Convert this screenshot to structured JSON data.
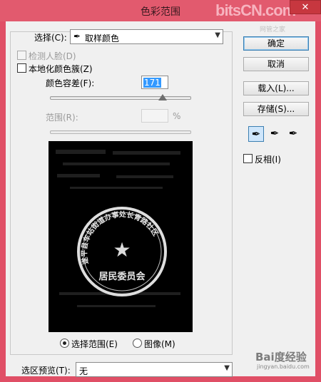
{
  "window": {
    "title": "色彩范围",
    "close_glyph": "✕"
  },
  "watermark": {
    "logo": "bitsCN.com",
    "small": "网管之家",
    "bottom": "Bai度经验",
    "bottom_sub": "jingyan.baidu.com"
  },
  "select_row": {
    "label": "选择(C):",
    "value": "取样颜色",
    "icon": "eyedropper-icon"
  },
  "options": {
    "detect_faces": "检测人脸(D)",
    "localized_clusters": "本地化颜色簇(Z)"
  },
  "fuzziness": {
    "label": "颜色容差(F):",
    "value": "171",
    "level": 0.8
  },
  "range": {
    "label": "范围(R):",
    "value": "",
    "unit": "%"
  },
  "stamp": {
    "ring_text": "遂平县车站街道办事处长青路社区",
    "center_text": "居民委员会",
    "star": "★"
  },
  "radios": {
    "selection": "选择范围(E)",
    "image": "图像(M)"
  },
  "buttons": {
    "ok": "确定",
    "cancel": "取消",
    "load": "载入(L)...",
    "save": "存储(S)..."
  },
  "eyedroppers": [
    {
      "name": "eyedropper-icon",
      "glyph": "✒"
    },
    {
      "name": "eyedropper-plus-icon",
      "glyph": "✒"
    },
    {
      "name": "eyedropper-minus-icon",
      "glyph": "✒"
    }
  ],
  "invert": {
    "label": "反相(I)"
  },
  "selection_preview": {
    "label": "选区预览(T):",
    "value": "无"
  },
  "colors": {
    "frame": "#e04f66",
    "dialog": "#f0f0f0",
    "highlight": "#3399ff"
  }
}
